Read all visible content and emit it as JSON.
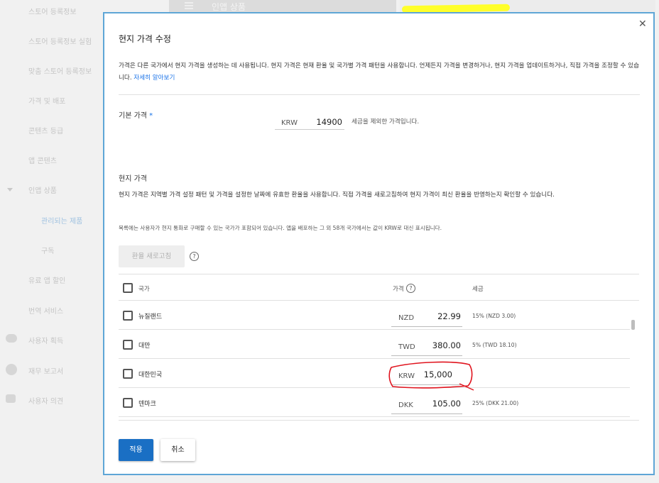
{
  "background": {
    "sidebar_items": [
      "스토어 등록정보",
      "스토어 등록정보 실험",
      "맞춤 스토어 등록정보",
      "가격 및 배포",
      "콘텐츠 등급",
      "앱 콘텐츠",
      "인앱 상품",
      "관리되는 제품",
      "구독",
      "유료 앱 할인",
      "번역 서비스",
      "사용자 획득",
      "재무 보고서",
      "사용자 의견"
    ],
    "topbar_title": "인앱 상품"
  },
  "dialog": {
    "title": "현지 가격 수정",
    "intro_text": "가격은 다른 국가에서 현지 가격을 생성하는 데 사용됩니다. 현지 가격은 현재 환율 및 국가별 가격 패턴을 사용합니다. 언제든지 가격을 변경하거나, 현지 가격을 업데이트하거나, 직접 가격을 조정할 수 있습니다.",
    "learn_more": "자세히 알아보기",
    "base_price": {
      "label": "기본 가격",
      "required_mark": "*",
      "currency": "KRW",
      "amount": "14900",
      "hint": "세금을 제외한 가격입니다."
    },
    "local_prices": {
      "title": "현지 가격",
      "description": "현지 가격은 지역별 가격 설정 패턴 및 가격을 설정한 날짜에 유효한 환율을 사용합니다. 직접 가격을 새로고침하여 현지 가격이 최신 환율을 반영하는지 확인할 수 있습니다.",
      "note": "목록에는 사용자가 현지 통화로 구매할 수 있는 국가가 포함되어 있습니다. 앱을 배포하는 그 외 58개 국가에서는 값이 KRW로 대신 표시됩니다.",
      "refresh_button": "환율 새로고침",
      "help_glyph": "?"
    },
    "table": {
      "headers": {
        "country": "국가",
        "price": "가격",
        "tax": "세금"
      },
      "rows": [
        {
          "country": "뉴질랜드",
          "currency": "NZD",
          "amount": "22.99",
          "tax": "15% (NZD 3.00)"
        },
        {
          "country": "대만",
          "currency": "TWD",
          "amount": "380.00",
          "tax": "5% (TWD 18.10)"
        },
        {
          "country": "대한민국",
          "currency": "KRW",
          "amount": "15,000",
          "tax": ""
        },
        {
          "country": "덴마크",
          "currency": "DKK",
          "amount": "105.00",
          "tax": "25% (DKK 21.00)"
        }
      ]
    },
    "actions": {
      "apply": "적용",
      "cancel": "취소",
      "close": "✕"
    }
  },
  "colors": {
    "primary": "#1a6fc4",
    "link": "#1a73e8",
    "dialog_border": "#5ea6d6",
    "annotation_red": "#e0141e",
    "annotation_yellow": "#ffff2a"
  }
}
